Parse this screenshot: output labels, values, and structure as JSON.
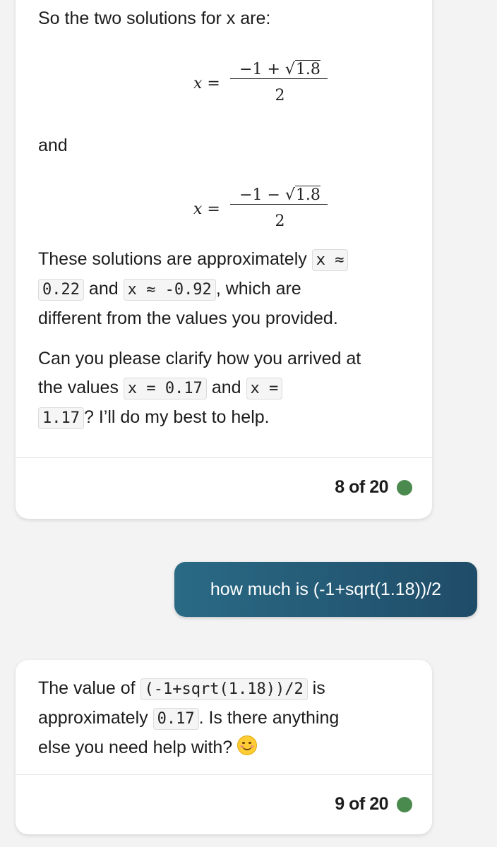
{
  "message_top": {
    "intro": "So the two solutions for x are:",
    "solution1": {
      "lhs": "x =",
      "numerator_prefix": "−1 + √",
      "radicand": "1.8",
      "denominator": "2"
    },
    "connector": "and",
    "solution2": {
      "lhs": "x =",
      "numerator_prefix": "−1 − √",
      "radicand": "1.8",
      "denominator": "2"
    },
    "p3": {
      "t1": "These solutions are approximately ",
      "c1a": "x ≈",
      "c1b": "0.22",
      "t2": " and ",
      "c2": "x ≈ -0.92",
      "t3": ", which are",
      "t4": "different from the values you provided."
    },
    "p4": {
      "t1": "Can you please clarify how you arrived at",
      "t2": "the values ",
      "c1": "x = 0.17",
      "t3": " and ",
      "c2a": "x =",
      "c2b": "1.17",
      "t4": "? I’ll do my best to help."
    },
    "counter": "8 of 20"
  },
  "user_message": {
    "text": "how much is (-1+sqrt(1.18))/2"
  },
  "message_bottom": {
    "t1": "The value of ",
    "c1": "(-1+sqrt(1.18))/2",
    "t2": " is",
    "t3": "approximately ",
    "c2": "0.17",
    "t4": ". Is there anything",
    "t5": "else you need help with? ",
    "emoji": "smiling-face-icon",
    "counter": "9 of 20"
  },
  "colors": {
    "page_background": "#f3f3f3",
    "card_background": "#ffffff",
    "user_bubble_start": "#2a6a85",
    "user_bubble_end": "#1f4c68",
    "status_dot": "#4a8a4e"
  }
}
